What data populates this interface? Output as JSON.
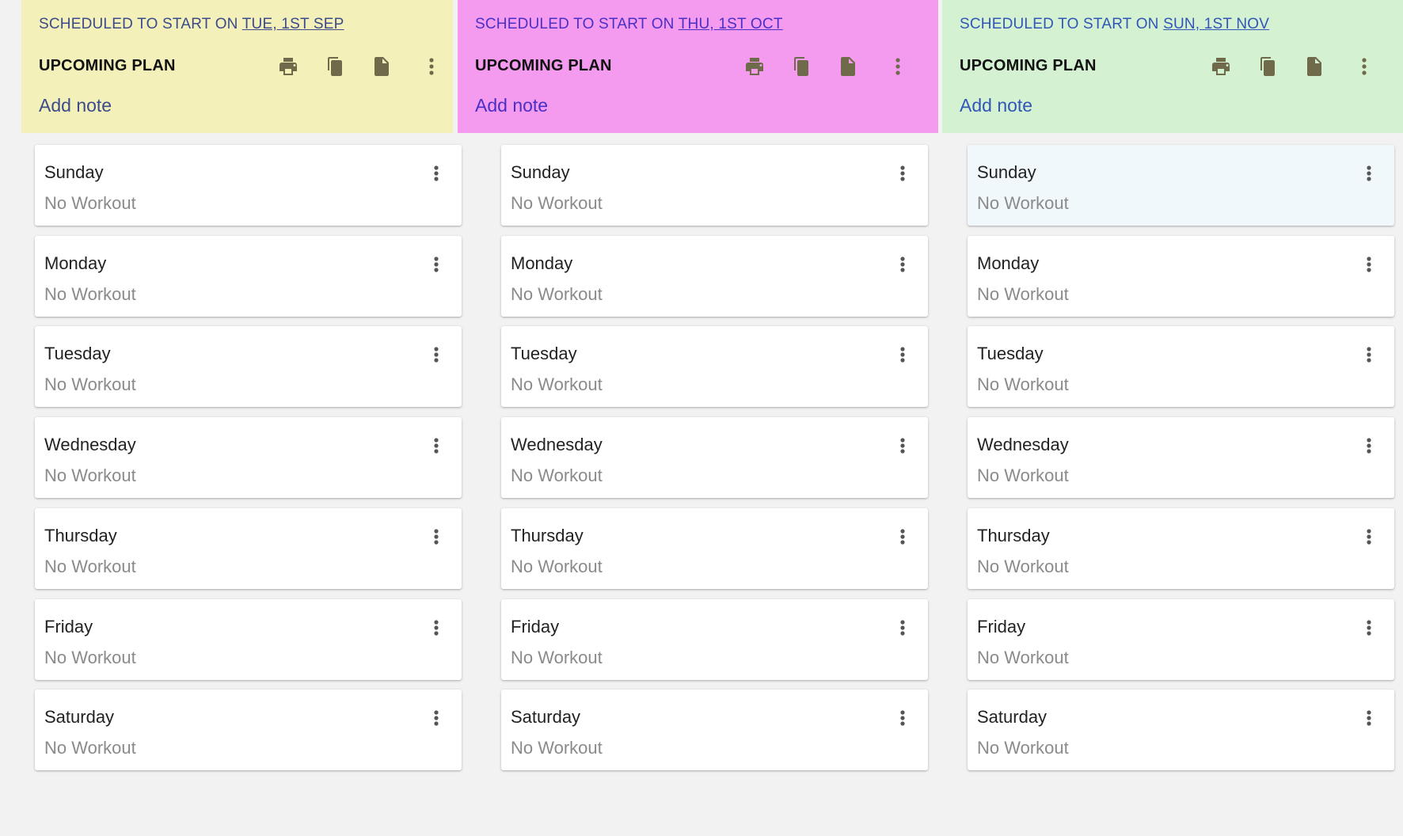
{
  "columns": [
    {
      "schedule_prefix": "SCHEDULED TO START ON ",
      "start_date": "TUE, 1ST SEP",
      "title": "UPCOMING PLAN",
      "add_note": "Add note",
      "header_bg": "#f3f1b9",
      "accent": "#3c4a8a",
      "icons": [
        "print-icon",
        "copy-icon",
        "document-icon",
        "more-vert-icon"
      ],
      "days": [
        {
          "name": "Sunday",
          "status": "No Workout"
        },
        {
          "name": "Monday",
          "status": "No Workout"
        },
        {
          "name": "Tuesday",
          "status": "No Workout"
        },
        {
          "name": "Wednesday",
          "status": "No Workout"
        },
        {
          "name": "Thursday",
          "status": "No Workout"
        },
        {
          "name": "Friday",
          "status": "No Workout"
        },
        {
          "name": "Saturday",
          "status": "No Workout"
        }
      ]
    },
    {
      "schedule_prefix": "SCHEDULED TO START ON ",
      "start_date": "THU, 1ST OCT",
      "title": "UPCOMING PLAN",
      "add_note": "Add note",
      "header_bg": "#f49bf0",
      "accent": "#4a2fc4",
      "icons": [
        "print-icon",
        "copy-icon",
        "document-icon",
        "more-vert-icon"
      ],
      "days": [
        {
          "name": "Sunday",
          "status": "No Workout"
        },
        {
          "name": "Monday",
          "status": "No Workout"
        },
        {
          "name": "Tuesday",
          "status": "No Workout"
        },
        {
          "name": "Wednesday",
          "status": "No Workout"
        },
        {
          "name": "Thursday",
          "status": "No Workout"
        },
        {
          "name": "Friday",
          "status": "No Workout"
        },
        {
          "name": "Saturday",
          "status": "No Workout"
        }
      ]
    },
    {
      "schedule_prefix": "SCHEDULED TO START ON ",
      "start_date": "SUN, 1ST NOV",
      "title": "UPCOMING PLAN",
      "add_note": "Add note",
      "header_bg": "#d4f1d2",
      "accent": "#3156b8",
      "icons": [
        "print-icon",
        "copy-icon",
        "document-icon",
        "more-vert-icon"
      ],
      "days": [
        {
          "name": "Sunday",
          "status": "No Workout",
          "highlighted": true
        },
        {
          "name": "Monday",
          "status": "No Workout"
        },
        {
          "name": "Tuesday",
          "status": "No Workout"
        },
        {
          "name": "Wednesday",
          "status": "No Workout"
        },
        {
          "name": "Thursday",
          "status": "No Workout"
        },
        {
          "name": "Friday",
          "status": "No Workout"
        },
        {
          "name": "Saturday",
          "status": "No Workout"
        }
      ]
    }
  ],
  "colors": {
    "page_bg": "#f2f2f2",
    "card_bg": "#ffffff",
    "card_highlight_bg": "#f1f8fc",
    "icon_color": "#6e6a4a",
    "status_text": "#8a8a8a"
  }
}
